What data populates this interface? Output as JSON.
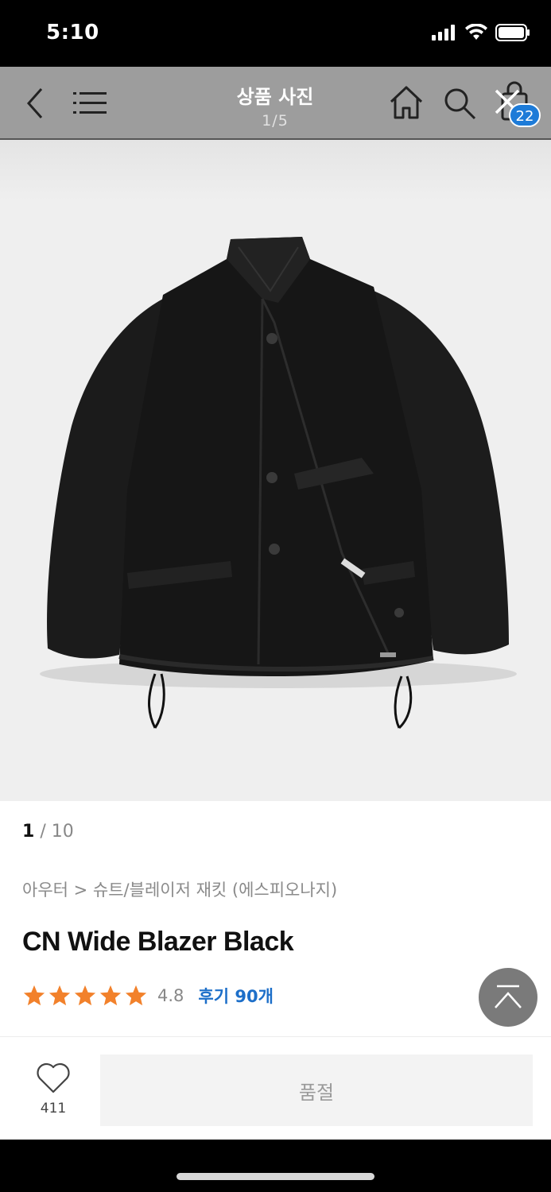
{
  "status_bar": {
    "time": "5:10"
  },
  "nav": {
    "title": "상품 사진",
    "counter": "1/5",
    "cart_count": "22"
  },
  "product": {
    "image_alt_icon": "jacket-photo",
    "image_index_current": "1",
    "image_index_total": "/ 10",
    "breadcrumb": "아우터 > 슈트/블레이저 재킷 (에스피오나지)",
    "name": "CN Wide Blazer Black",
    "rating": "4.8",
    "stars": 5,
    "review_link": "후기 90개"
  },
  "bottom": {
    "wish_count": "411",
    "sold_out_label": "품절"
  },
  "colors": {
    "star": "#f2812b",
    "accent_blue": "#1d6fc9",
    "badge_blue": "#1d7bd8"
  }
}
